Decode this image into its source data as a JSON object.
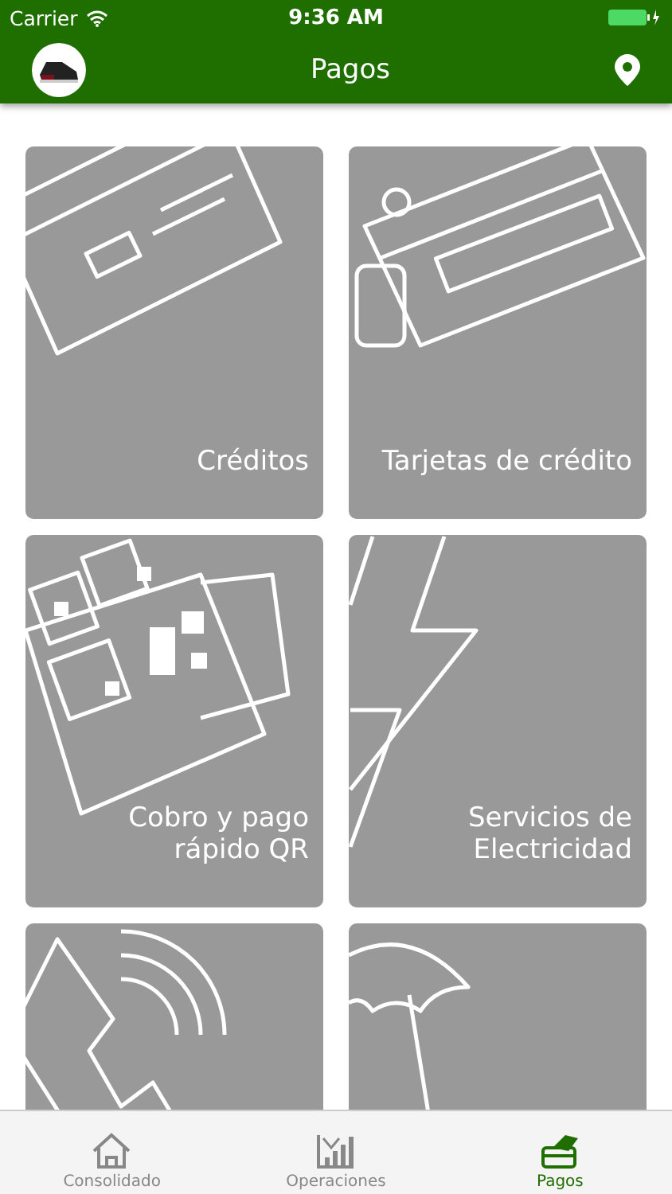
{
  "status_bar": {
    "carrier": "Carrier",
    "time": "9:36 AM"
  },
  "nav_bar": {
    "title": "Pagos"
  },
  "tiles": [
    {
      "kind": "card",
      "label": "Créditos"
    },
    {
      "kind": "credit-card",
      "label": "Tarjetas de crédito"
    },
    {
      "kind": "qr",
      "label": "Cobro y pago rápido QR"
    },
    {
      "kind": "bolt",
      "label": "Servicios de Electricidad"
    },
    {
      "kind": "phone"
    },
    {
      "kind": "umbrella"
    }
  ],
  "tab_bar": [
    {
      "kind": "home",
      "label": "Consolidado",
      "selected": false
    },
    {
      "kind": "chart",
      "label": "Operaciones",
      "selected": false
    },
    {
      "kind": "pay",
      "label": "Pagos",
      "selected": true
    }
  ]
}
